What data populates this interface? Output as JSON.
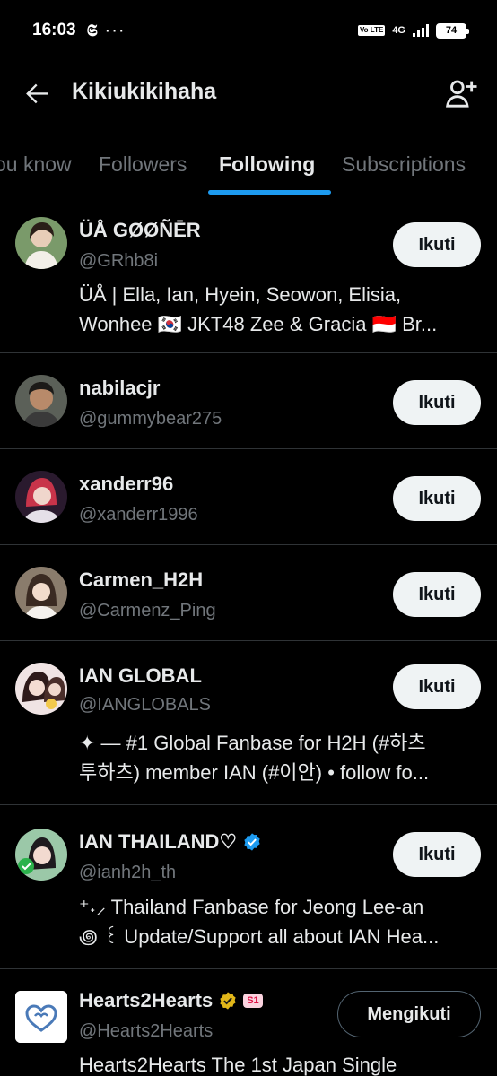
{
  "status_bar": {
    "time": "16:03",
    "app_icon": "𝕾",
    "more": "···",
    "volte": "Vo LTE",
    "network": "4G",
    "battery": "74"
  },
  "header": {
    "title": "Kikiukikihaha"
  },
  "tabs": [
    {
      "label": "ou know",
      "active": false
    },
    {
      "label": "Followers",
      "active": false
    },
    {
      "label": "Following",
      "active": true
    },
    {
      "label": "Subscriptions",
      "active": false
    }
  ],
  "accounts": [
    {
      "name": "ÜÅ GØØÑĒR",
      "handle": "@GRhb8i",
      "bio": [
        "ÜÅ | Ella, Ian, Hyein, Seowon, Elisia,",
        "Wonhee 🇰🇷 JKT48 Zee & Gracia 🇮🇩 Br..."
      ],
      "button": "Ikuti"
    },
    {
      "name": "nabilacjr",
      "handle": "@gummybear275",
      "bio": [],
      "button": "Ikuti"
    },
    {
      "name": "xanderr96",
      "handle": "@xanderr1996",
      "bio": [],
      "button": "Ikuti"
    },
    {
      "name": "Carmen_H2H",
      "handle": "@Carmenz_Ping",
      "bio": [],
      "button": "Ikuti"
    },
    {
      "name": "IAN GLOBAL",
      "handle": "@IANGLOBALS",
      "bio": [
        "✦ — #1 Global Fanbase for H2H (#하츠",
        "투하츠) member IAN (#이안) • follow fo..."
      ],
      "button": "Ikuti"
    },
    {
      "name": "IAN THAILAND♡",
      "handle": "@ianh2h_th",
      "bio": [
        "⁺˖⸝ Thailand Fanbase for Jeong Lee-an",
        "꩜ ꒰ Update/Support all about IAN Hea..."
      ],
      "button": "Ikuti"
    },
    {
      "name": "Hearts2Hearts",
      "handle": "@Hearts2Hearts",
      "badge": "S1",
      "bio": [
        "Hearts2Hearts The 1st Japan Single"
      ],
      "button": "Mengikuti"
    }
  ],
  "colors": {
    "background": "#000000",
    "accent": "#1d9bf0",
    "muted": "#71767b",
    "divider": "#2f3336"
  }
}
